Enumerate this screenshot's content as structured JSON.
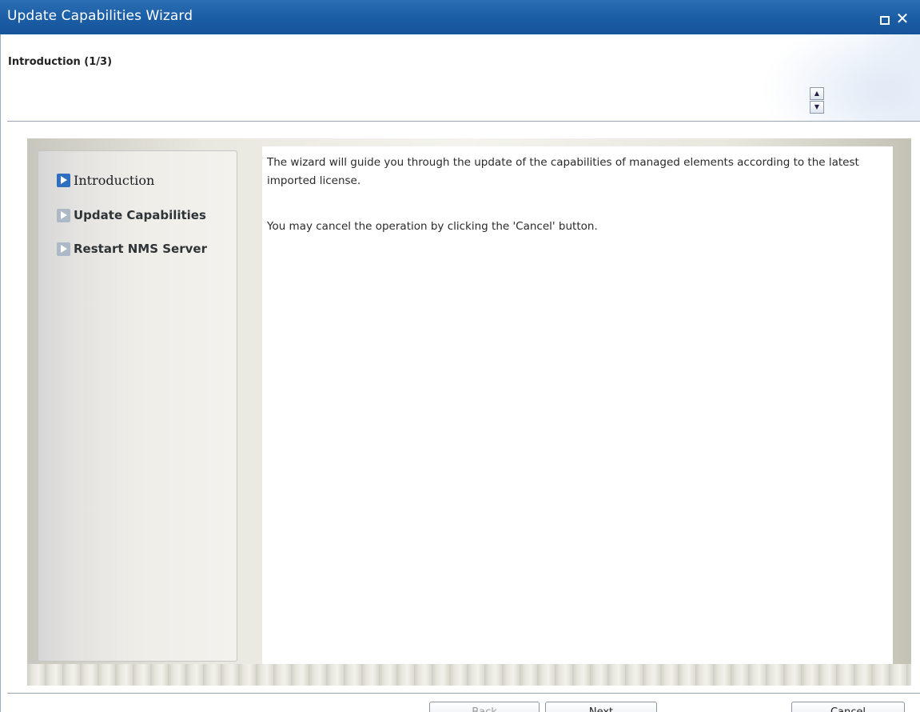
{
  "window": {
    "title": "Update Capabilities Wizard"
  },
  "header": {
    "step_heading": "Introduction (1/3)"
  },
  "nav": {
    "items": [
      {
        "label": "Introduction",
        "active": true
      },
      {
        "label": "Update Capabilities",
        "active": false
      },
      {
        "label": "Restart NMS Server",
        "active": false
      }
    ]
  },
  "content": {
    "paragraph1": "The wizard will guide you through the update of the capabilities of managed elements according to the latest imported license.",
    "paragraph2": "You may cancel the operation by clicking the 'Cancel' button."
  },
  "footer": {
    "back_label": "Back",
    "next_label": "Next",
    "cancel_label": "Cancel"
  },
  "colors": {
    "titlebar": "#1b5ea6",
    "active_step_icon": "#2f6fc0",
    "inactive_step_icon": "#aeb9c7"
  }
}
